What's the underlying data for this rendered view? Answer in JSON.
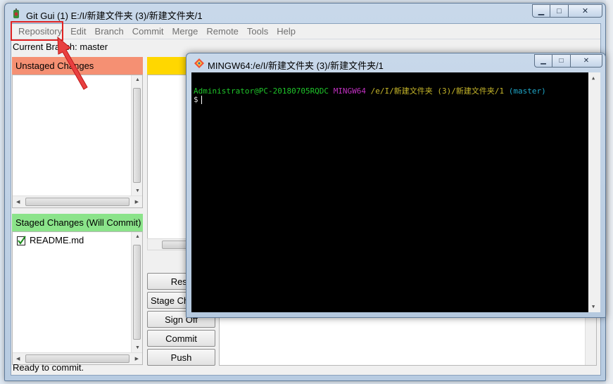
{
  "window": {
    "title": "Git Gui (1) E:/I/新建文件夹 (3)/新建文件夹/1",
    "min_label": "▁",
    "max_label": "□",
    "close_label": "✕"
  },
  "menu": [
    {
      "label": "Repository"
    },
    {
      "label": "Edit"
    },
    {
      "label": "Branch"
    },
    {
      "label": "Commit"
    },
    {
      "label": "Merge"
    },
    {
      "label": "Remote"
    },
    {
      "label": "Tools"
    },
    {
      "label": "Help"
    }
  ],
  "branch": {
    "label": "Current Branch: master"
  },
  "unstaged": {
    "title": "Unstaged Changes",
    "color": "#f59073"
  },
  "staged": {
    "title": "Staged Changes (Will Commit)",
    "color": "#8be38a",
    "files": [
      {
        "name": "README.md",
        "icon": "checked-file-icon"
      }
    ]
  },
  "diff": {
    "header_color": "#ffd700"
  },
  "actions": {
    "rescan": "Resc",
    "stage_changed": "Stage Ch",
    "sign_off": "Sign Off",
    "commit": "Commit",
    "push": "Push"
  },
  "status": {
    "text": "Ready to commit."
  },
  "terminal": {
    "title": "MINGW64:/e/I/新建文件夹 (3)/新建文件夹/1",
    "prompt_user": "Administrator@PC-20180705RQDC",
    "prompt_env": "MINGW64",
    "prompt_path": "/e/I/新建文件夹 (3)/新建文件夹/1",
    "prompt_branch": "(master)",
    "prompt_symbol": "$"
  },
  "annotation": {
    "color": "#e02222"
  }
}
